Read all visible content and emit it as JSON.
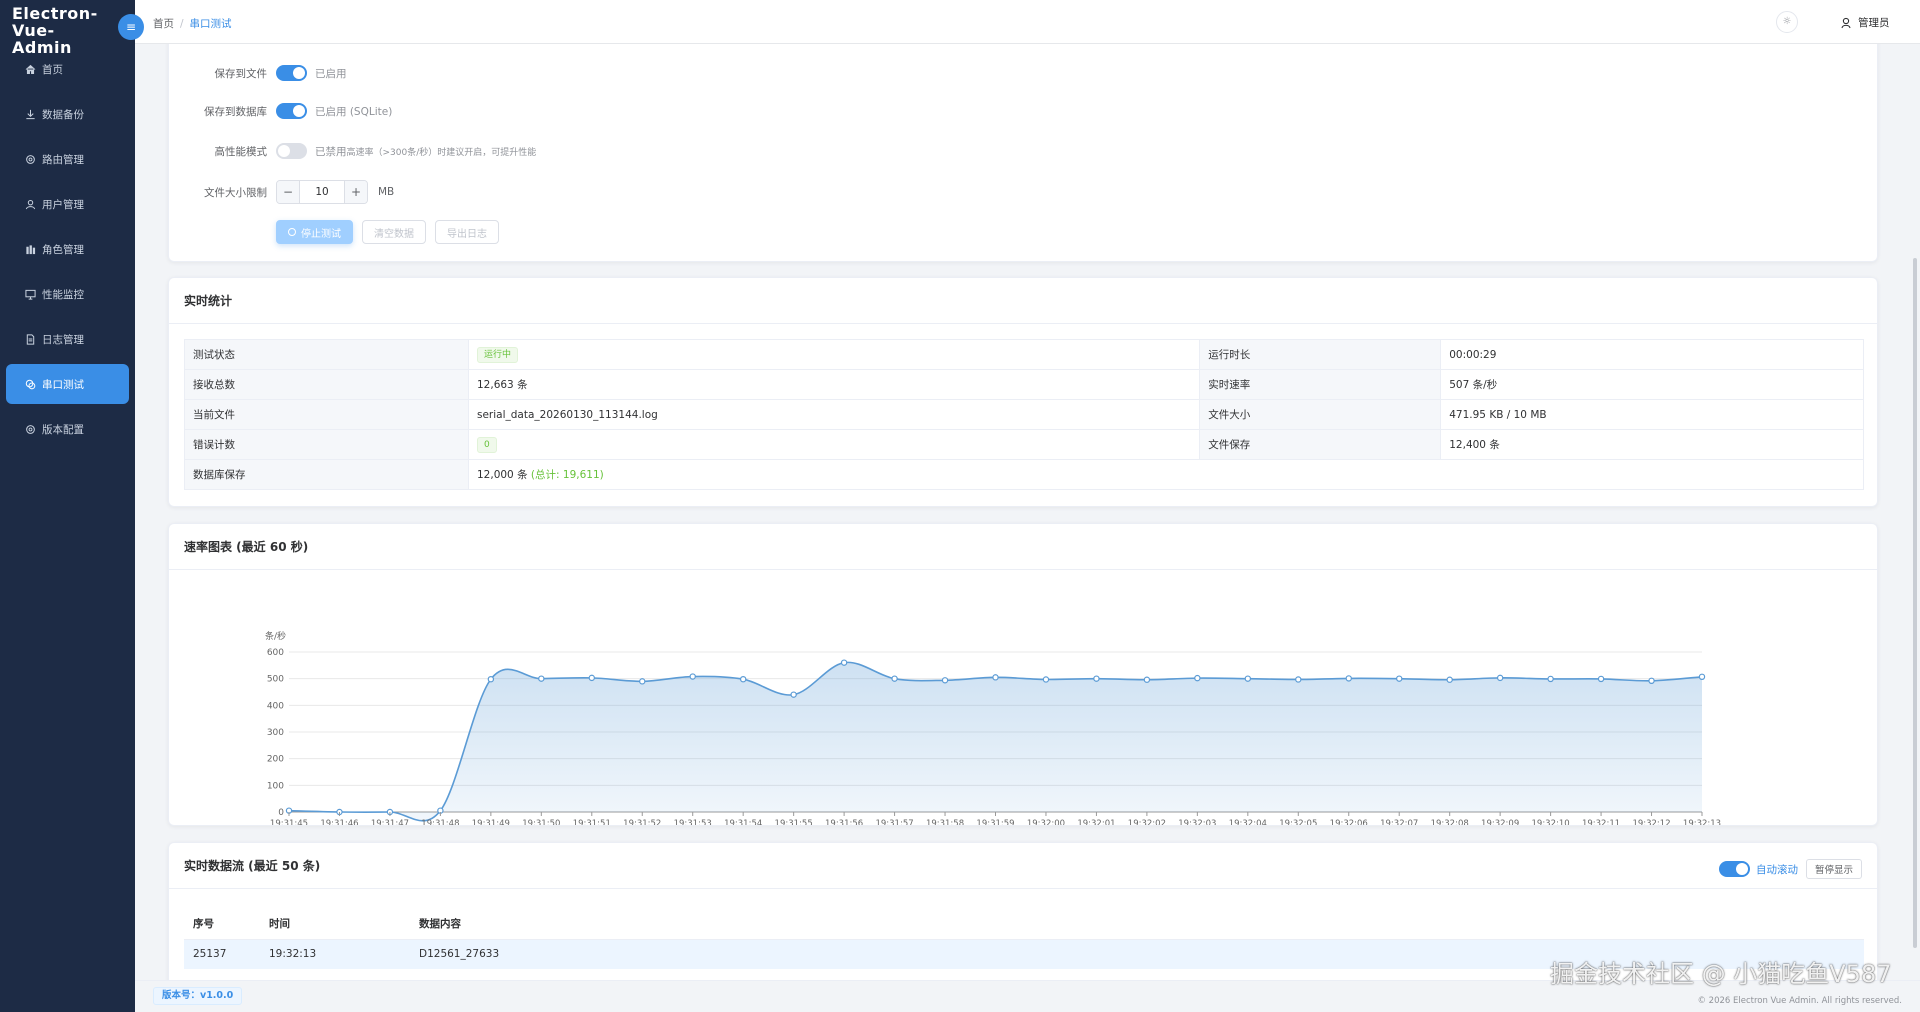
{
  "app": {
    "brand_line1": "Electron-Vue-",
    "brand_line2": "Admin",
    "collapse_icon": "≡"
  },
  "sidebar": {
    "items": [
      {
        "label": "首页",
        "icon": "home-icon"
      },
      {
        "label": "数据备份",
        "icon": "download-icon"
      },
      {
        "label": "路由管理",
        "icon": "gear-icon"
      },
      {
        "label": "用户管理",
        "icon": "user-icon"
      },
      {
        "label": "角色管理",
        "icon": "role-icon"
      },
      {
        "label": "性能监控",
        "icon": "monitor-icon"
      },
      {
        "label": "日志管理",
        "icon": "document-icon"
      },
      {
        "label": "串口测试",
        "icon": "serial-icon",
        "active": true
      },
      {
        "label": "版本配置",
        "icon": "gear-icon"
      }
    ]
  },
  "header": {
    "breadcrumb": [
      "首页",
      "串口测试"
    ],
    "user_name": "管理员",
    "theme_icon": "☼"
  },
  "settings": {
    "save_file_label": "保存到文件",
    "save_file_status": "已启用",
    "save_db_label": "保存到数据库",
    "save_db_status": "已启用 (SQLite)",
    "perf_mode_label": "高性能模式",
    "perf_mode_status": "已禁用",
    "perf_mode_hint": "高速率（>300条/秒）时建议开启，可提升性能",
    "file_limit_label": "文件大小限制",
    "file_limit_value": "10",
    "file_limit_unit": "MB",
    "minus": "−",
    "plus": "+",
    "stop_button": "停止测试",
    "clear_button": "清空数据",
    "export_button": "导出日志"
  },
  "stats": {
    "title": "实时统计",
    "rows": [
      {
        "l1": "测试状态",
        "v1": "运行中",
        "l2": "运行时长",
        "v2": "00:00:29"
      },
      {
        "l1": "接收总数",
        "v1": "12,663 条",
        "l2": "实时速率",
        "v2": "507 条/秒"
      },
      {
        "l1": "当前文件",
        "v1": "serial_data_20260130_113144.log",
        "l2": "文件大小",
        "v2": "471.95 KB / 10 MB"
      },
      {
        "l1": "错误计数",
        "v1": "0",
        "l2": "文件保存",
        "v2": "12,400 条"
      },
      {
        "l1": "数据库保存",
        "v1": "12,000 条",
        "v1_extra": "(总计: 19,611)"
      }
    ]
  },
  "chart_card": {
    "title": "速率图表 (最近 60 秒)"
  },
  "chart_data": {
    "type": "area",
    "title": "速率图表 (最近 60 秒)",
    "ylabel": "条/秒",
    "ylim": [
      0,
      600
    ],
    "yticks": [
      0,
      100,
      200,
      300,
      400,
      500,
      600
    ],
    "grid": true,
    "color": "#5b9bd5",
    "x": [
      "19:31:45",
      "19:31:46",
      "19:31:47",
      "19:31:48",
      "19:31:49",
      "19:31:50",
      "19:31:51",
      "19:31:52",
      "19:31:53",
      "19:31:54",
      "19:31:55",
      "19:31:56",
      "19:31:57",
      "19:31:58",
      "19:31:59",
      "19:32:00",
      "19:32:01",
      "19:32:02",
      "19:32:03",
      "19:32:04",
      "19:32:05",
      "19:32:06",
      "19:32:07",
      "19:32:08",
      "19:32:09",
      "19:32:10",
      "19:32:11",
      "19:32:12",
      "19:32:13"
    ],
    "values": [
      5,
      0,
      0,
      5,
      498,
      500,
      503,
      490,
      508,
      498,
      440,
      560,
      500,
      494,
      505,
      497,
      500,
      496,
      502,
      500,
      497,
      501,
      500,
      496,
      503,
      499,
      499,
      492,
      507
    ]
  },
  "stream": {
    "title": "实时数据流 (最近 50 条)",
    "auto_scroll_label": "自动滚动",
    "pause_button": "暂停显示",
    "columns": [
      "序号",
      "时间",
      "数据内容"
    ],
    "rows": [
      [
        "25137",
        "19:32:13",
        "D12561_27633"
      ]
    ]
  },
  "footer": {
    "version": "版本号：v1.0.0",
    "copyright": "© 2026 Electron Vue Admin. All rights reserved."
  },
  "watermark": "掘金技术社区 @ 小猫吃鱼V587"
}
